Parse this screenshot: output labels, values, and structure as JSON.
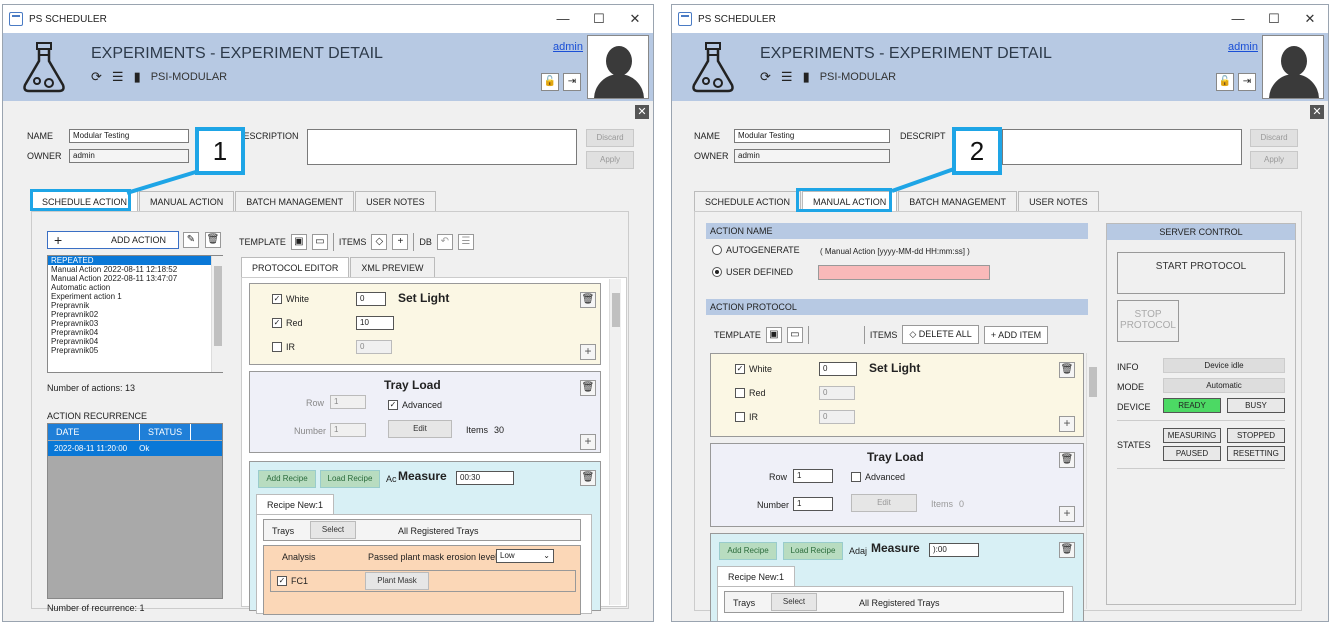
{
  "window": {
    "title": "PS SCHEDULER",
    "min": "—",
    "max": "☐",
    "close": "✕"
  },
  "header": {
    "title": "EXPERIMENTS - EXPERIMENT DETAIL",
    "subtitle": "PSI-MODULAR",
    "user": "admin"
  },
  "form": {
    "name_label": "NAME",
    "name_value": "Modular Testing",
    "owner_label": "OWNER",
    "owner_value": "admin",
    "description_label": "DESCRIPTION",
    "description_label_short": "DESCRIPT",
    "discard": "Discard",
    "apply": "Apply"
  },
  "tabs": [
    "SCHEDULE ACTION",
    "MANUAL ACTION",
    "BATCH MANAGEMENT",
    "USER NOTES"
  ],
  "callouts": [
    "1",
    "2"
  ],
  "left": {
    "add_action": "ADD ACTION",
    "actions": [
      "REPEATED",
      "Manual Action 2022-08-11  12:18:52",
      "Manual Action 2022-08-11  13:47:07",
      "Automatic action",
      "Experiment action 1",
      "Prepravnik",
      "Prepravnik02",
      "Prepravnik03",
      "Prepravnik04",
      "Prepravnik04",
      "Prepravnik05"
    ],
    "actions_count": "Number of actions: 13",
    "recurrence_title": "ACTION RECURRENCE",
    "rec_cols": [
      "DATE",
      "STATUS"
    ],
    "rec_row": [
      "2022-08-11  11:20:00",
      "Ok"
    ],
    "rec_count": "Number of recurrence: 1",
    "template": "TEMPLATE",
    "items": "ITEMS",
    "db": "DB",
    "subtabs": [
      "PROTOCOL EDITOR",
      "XML PREVIEW"
    ]
  },
  "cards": {
    "set_light": "Set Light",
    "white": "White",
    "red": "Red",
    "ir": "IR",
    "white_val": "0",
    "red_val": "10",
    "ir_val": "0",
    "red_val_r": "0",
    "tray_load": "Tray Load",
    "row": "Row",
    "row_val": "1",
    "number": "Number",
    "number_val": "1",
    "advanced": "Advanced",
    "edit": "Edit",
    "items": "Items",
    "items_val_l": "30",
    "items_val_r": "0",
    "add_recipe": "Add Recipe",
    "load_recipe": "Load Recipe",
    "ac_prefix_l": "Ac",
    "ac_prefix_r": "Adaj",
    "measure": "Measure",
    "time_l": "00:30",
    "time_r": "):00",
    "recipe_new": "Recipe New:1",
    "trays": "Trays",
    "select": "Select",
    "all_trays": "All Registered Trays",
    "analysis": "Analysis",
    "erosion": "Passed plant mask erosion level:",
    "erosion_val": "Low",
    "fc1": "FC1",
    "plant_mask": "Plant Mask"
  },
  "right": {
    "action_name": "ACTION NAME",
    "autogenerate": "AUTOGENERATE",
    "auto_fmt": "( Manual Action [yyyy-MM-dd  HH:mm:ss] )",
    "user_defined": "USER DEFINED",
    "action_protocol": "ACTION PROTOCOL",
    "delete_all": "DELETE ALL",
    "add_item": "ADD ITEM",
    "server_control": "SERVER CONTROL",
    "start_protocol": "START PROTOCOL",
    "stop_protocol": "STOP PROTOCOL",
    "info": "INFO",
    "info_val": "Device idle",
    "mode": "MODE",
    "mode_val": "Automatic",
    "device": "DEVICE",
    "ready": "READY",
    "busy": "BUSY",
    "states": "STATES",
    "measuring": "MEASURING",
    "stopped": "STOPPED",
    "paused": "PAUSED",
    "resetting": "RESETTING"
  }
}
